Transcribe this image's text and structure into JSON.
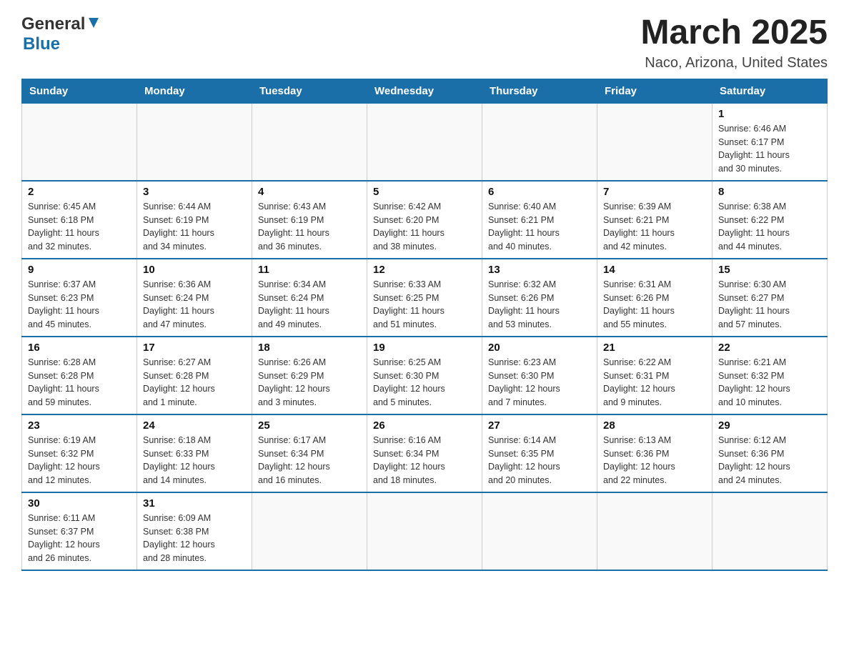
{
  "header": {
    "logo_general": "General",
    "logo_blue": "Blue",
    "title": "March 2025",
    "subtitle": "Naco, Arizona, United States"
  },
  "days_of_week": [
    "Sunday",
    "Monday",
    "Tuesday",
    "Wednesday",
    "Thursday",
    "Friday",
    "Saturday"
  ],
  "weeks": [
    [
      {
        "num": "",
        "info": ""
      },
      {
        "num": "",
        "info": ""
      },
      {
        "num": "",
        "info": ""
      },
      {
        "num": "",
        "info": ""
      },
      {
        "num": "",
        "info": ""
      },
      {
        "num": "",
        "info": ""
      },
      {
        "num": "1",
        "info": "Sunrise: 6:46 AM\nSunset: 6:17 PM\nDaylight: 11 hours\nand 30 minutes."
      }
    ],
    [
      {
        "num": "2",
        "info": "Sunrise: 6:45 AM\nSunset: 6:18 PM\nDaylight: 11 hours\nand 32 minutes."
      },
      {
        "num": "3",
        "info": "Sunrise: 6:44 AM\nSunset: 6:19 PM\nDaylight: 11 hours\nand 34 minutes."
      },
      {
        "num": "4",
        "info": "Sunrise: 6:43 AM\nSunset: 6:19 PM\nDaylight: 11 hours\nand 36 minutes."
      },
      {
        "num": "5",
        "info": "Sunrise: 6:42 AM\nSunset: 6:20 PM\nDaylight: 11 hours\nand 38 minutes."
      },
      {
        "num": "6",
        "info": "Sunrise: 6:40 AM\nSunset: 6:21 PM\nDaylight: 11 hours\nand 40 minutes."
      },
      {
        "num": "7",
        "info": "Sunrise: 6:39 AM\nSunset: 6:21 PM\nDaylight: 11 hours\nand 42 minutes."
      },
      {
        "num": "8",
        "info": "Sunrise: 6:38 AM\nSunset: 6:22 PM\nDaylight: 11 hours\nand 44 minutes."
      }
    ],
    [
      {
        "num": "9",
        "info": "Sunrise: 6:37 AM\nSunset: 6:23 PM\nDaylight: 11 hours\nand 45 minutes."
      },
      {
        "num": "10",
        "info": "Sunrise: 6:36 AM\nSunset: 6:24 PM\nDaylight: 11 hours\nand 47 minutes."
      },
      {
        "num": "11",
        "info": "Sunrise: 6:34 AM\nSunset: 6:24 PM\nDaylight: 11 hours\nand 49 minutes."
      },
      {
        "num": "12",
        "info": "Sunrise: 6:33 AM\nSunset: 6:25 PM\nDaylight: 11 hours\nand 51 minutes."
      },
      {
        "num": "13",
        "info": "Sunrise: 6:32 AM\nSunset: 6:26 PM\nDaylight: 11 hours\nand 53 minutes."
      },
      {
        "num": "14",
        "info": "Sunrise: 6:31 AM\nSunset: 6:26 PM\nDaylight: 11 hours\nand 55 minutes."
      },
      {
        "num": "15",
        "info": "Sunrise: 6:30 AM\nSunset: 6:27 PM\nDaylight: 11 hours\nand 57 minutes."
      }
    ],
    [
      {
        "num": "16",
        "info": "Sunrise: 6:28 AM\nSunset: 6:28 PM\nDaylight: 11 hours\nand 59 minutes."
      },
      {
        "num": "17",
        "info": "Sunrise: 6:27 AM\nSunset: 6:28 PM\nDaylight: 12 hours\nand 1 minute."
      },
      {
        "num": "18",
        "info": "Sunrise: 6:26 AM\nSunset: 6:29 PM\nDaylight: 12 hours\nand 3 minutes."
      },
      {
        "num": "19",
        "info": "Sunrise: 6:25 AM\nSunset: 6:30 PM\nDaylight: 12 hours\nand 5 minutes."
      },
      {
        "num": "20",
        "info": "Sunrise: 6:23 AM\nSunset: 6:30 PM\nDaylight: 12 hours\nand 7 minutes."
      },
      {
        "num": "21",
        "info": "Sunrise: 6:22 AM\nSunset: 6:31 PM\nDaylight: 12 hours\nand 9 minutes."
      },
      {
        "num": "22",
        "info": "Sunrise: 6:21 AM\nSunset: 6:32 PM\nDaylight: 12 hours\nand 10 minutes."
      }
    ],
    [
      {
        "num": "23",
        "info": "Sunrise: 6:19 AM\nSunset: 6:32 PM\nDaylight: 12 hours\nand 12 minutes."
      },
      {
        "num": "24",
        "info": "Sunrise: 6:18 AM\nSunset: 6:33 PM\nDaylight: 12 hours\nand 14 minutes."
      },
      {
        "num": "25",
        "info": "Sunrise: 6:17 AM\nSunset: 6:34 PM\nDaylight: 12 hours\nand 16 minutes."
      },
      {
        "num": "26",
        "info": "Sunrise: 6:16 AM\nSunset: 6:34 PM\nDaylight: 12 hours\nand 18 minutes."
      },
      {
        "num": "27",
        "info": "Sunrise: 6:14 AM\nSunset: 6:35 PM\nDaylight: 12 hours\nand 20 minutes."
      },
      {
        "num": "28",
        "info": "Sunrise: 6:13 AM\nSunset: 6:36 PM\nDaylight: 12 hours\nand 22 minutes."
      },
      {
        "num": "29",
        "info": "Sunrise: 6:12 AM\nSunset: 6:36 PM\nDaylight: 12 hours\nand 24 minutes."
      }
    ],
    [
      {
        "num": "30",
        "info": "Sunrise: 6:11 AM\nSunset: 6:37 PM\nDaylight: 12 hours\nand 26 minutes."
      },
      {
        "num": "31",
        "info": "Sunrise: 6:09 AM\nSunset: 6:38 PM\nDaylight: 12 hours\nand 28 minutes."
      },
      {
        "num": "",
        "info": ""
      },
      {
        "num": "",
        "info": ""
      },
      {
        "num": "",
        "info": ""
      },
      {
        "num": "",
        "info": ""
      },
      {
        "num": "",
        "info": ""
      }
    ]
  ]
}
